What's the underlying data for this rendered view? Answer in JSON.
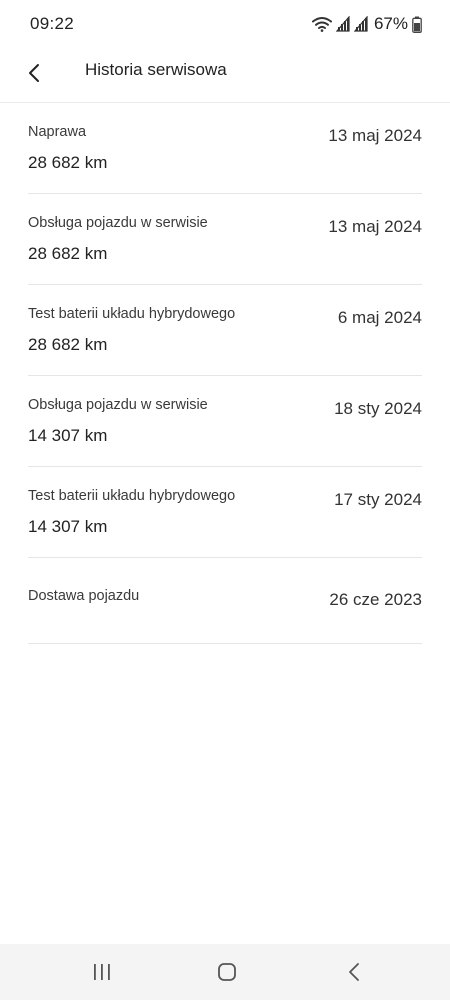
{
  "status_bar": {
    "time": "09:22",
    "battery_percent": "67%",
    "icons": [
      "wifi-icon",
      "signal-icon",
      "signal-icon",
      "battery-icon"
    ]
  },
  "header": {
    "title": "Historia serwisowa",
    "back_icon": "chevron-left-icon"
  },
  "service_history": [
    {
      "name": "Naprawa",
      "date": "13 maj 2024",
      "mileage": "28 682 km"
    },
    {
      "name": "Obsługa pojazdu w serwisie",
      "date": "13 maj 2024",
      "mileage": "28 682 km"
    },
    {
      "name": "Test baterii układu hybrydowego",
      "date": "6 maj 2024",
      "mileage": "28 682 km"
    },
    {
      "name": "Obsługa pojazdu w serwisie",
      "date": "18 sty 2024",
      "mileage": "14 307 km"
    },
    {
      "name": "Test baterii układu hybrydowego",
      "date": "17 sty 2024",
      "mileage": "14 307 km"
    },
    {
      "name": "Dostawa pojazdu",
      "date": "26 cze 2023"
    }
  ],
  "nav_bar": {
    "icons": [
      "recents-icon",
      "home-icon",
      "back-icon"
    ]
  }
}
